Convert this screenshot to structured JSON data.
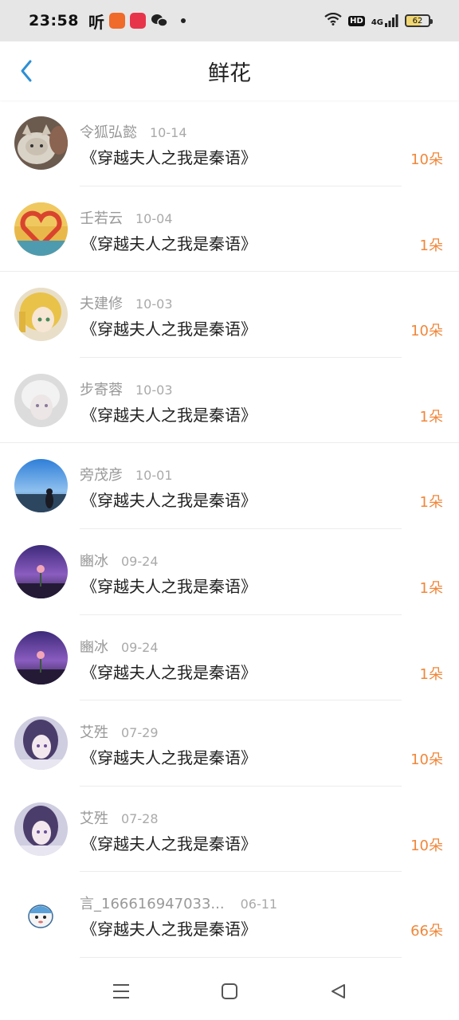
{
  "status": {
    "time": "23:58",
    "ting": "听",
    "battery": "62",
    "hd": "HD",
    "network": "4G"
  },
  "header": {
    "title": "鲜花",
    "back_icon": "chevron-left-icon"
  },
  "colors": {
    "accent": "#2d8fd5",
    "count": "#f0873a",
    "name": "#999999",
    "text": "#222222"
  },
  "items": [
    {
      "name": "令狐弘懿",
      "date": "10-14",
      "book": "《穿越夫人之我是秦语》",
      "count": "10朵"
    },
    {
      "name": "壬若云",
      "date": "10-04",
      "book": "《穿越夫人之我是秦语》",
      "count": "1朵"
    },
    {
      "name": "夫建修",
      "date": "10-03",
      "book": "《穿越夫人之我是秦语》",
      "count": "10朵"
    },
    {
      "name": "步寄蓉",
      "date": "10-03",
      "book": "《穿越夫人之我是秦语》",
      "count": "1朵"
    },
    {
      "name": "旁茂彦",
      "date": "10-01",
      "book": "《穿越夫人之我是秦语》",
      "count": "1朵"
    },
    {
      "name": "豳冰",
      "date": "09-24",
      "book": "《穿越夫人之我是秦语》",
      "count": "1朵"
    },
    {
      "name": "豳冰",
      "date": "09-24",
      "book": "《穿越夫人之我是秦语》",
      "count": "1朵"
    },
    {
      "name": "艾殅",
      "date": "07-29",
      "book": "《穿越夫人之我是秦语》",
      "count": "10朵"
    },
    {
      "name": "艾殅",
      "date": "07-28",
      "book": "《穿越夫人之我是秦语》",
      "count": "10朵"
    },
    {
      "name": "言_166616947033...",
      "date": "06-11",
      "book": "《穿越夫人之我是秦语》",
      "count": "66朵"
    }
  ],
  "nav": {
    "menu_icon": "menu-icon",
    "home_icon": "home-icon",
    "back_icon": "back-triangle-icon"
  }
}
